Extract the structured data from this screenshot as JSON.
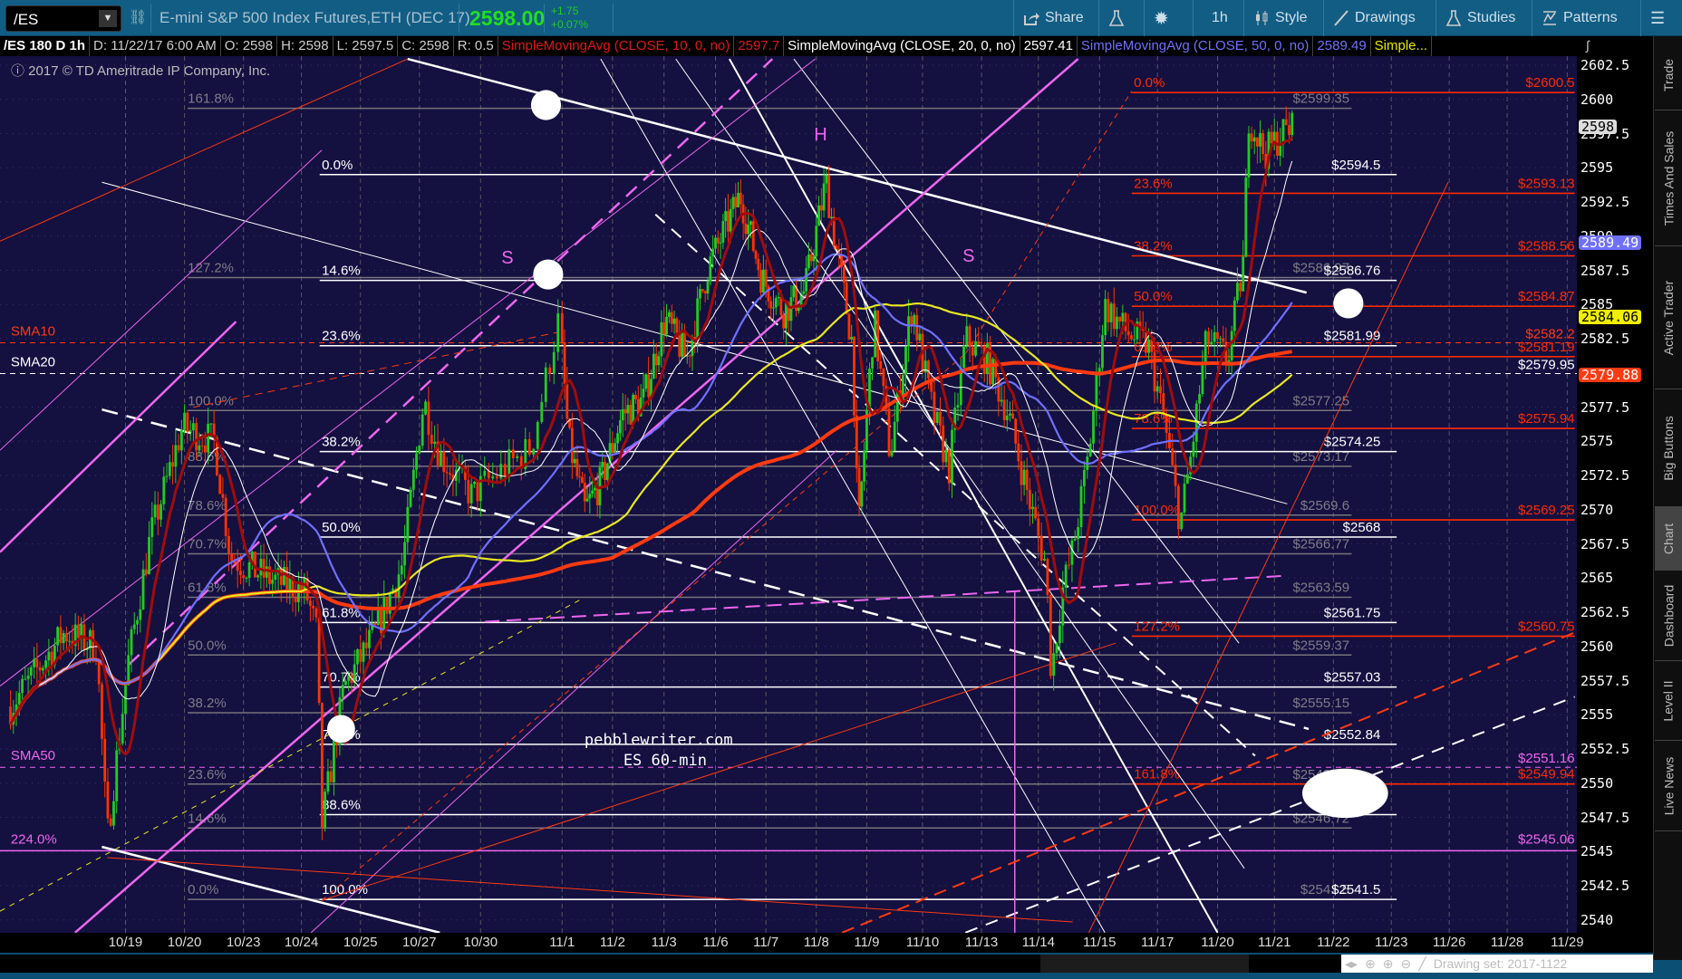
{
  "toolbar": {
    "symbol": "/ES",
    "instrument": "E-mini S&P 500 Index Futures,ETH (DEC 17)",
    "last": "2598.00",
    "change": "+1.75",
    "change_pct": "+0.07%",
    "share": "Share",
    "timeframe": "1h",
    "style": "Style",
    "drawings": "Drawings",
    "studies": "Studies",
    "patterns": "Patterns"
  },
  "infobar": {
    "sym": "/ES 180 D 1h",
    "date": "D: 11/22/17 6:00 AM",
    "open": "O: 2598",
    "high": "H: 2598",
    "low": "L: 2597.5",
    "close": "C: 2598",
    "range": "R: 0.5",
    "sma10": "SimpleMovingAvg (CLOSE, 10, 0, no)",
    "sma10_val": "2597.7",
    "sma20": "SimpleMovingAvg (CLOSE, 20, 0, no)",
    "sma20_val": "2597.41",
    "sma50": "SimpleMovingAvg (CLOSE, 50, 0, no)",
    "sma50_val": "2589.49",
    "more": "Simple..."
  },
  "copyright": "2017 © TD Ameritrade IP Company, Inc.",
  "tabs": [
    "Trade",
    "Times And Sales",
    "Active Trader",
    "Big Buttons",
    "Chart",
    "Dashboard",
    "Level II",
    "Live News"
  ],
  "selected_tab": "Chart",
  "bottom": {
    "drawing_set": "Drawing set: 2017-1122"
  },
  "colors": {
    "bg": "#141040",
    "up": "#22cc22",
    "down": "#ff3300",
    "sma10": "#a00c0c",
    "sma20": "#ffffff",
    "sma50": "#7070ff",
    "sma100": "#e8e820",
    "sma200": "#ff3a10",
    "magenta": "#ee66ee"
  },
  "chart_data": {
    "type": "candlestick",
    "title": "/ES 180 D 1h",
    "ylim": [
      2538.5,
      2603.5
    ],
    "y_ticks": [
      "2602.5",
      "2600",
      "2597.5",
      "2595",
      "2592.5",
      "2590",
      "2587.5",
      "2585",
      "2582.5",
      "2580",
      "2577.5",
      "2575",
      "2572.5",
      "2570",
      "2567.5",
      "2565",
      "2562.5",
      "2560",
      "2557.5",
      "2555",
      "2552.5",
      "2550",
      "2547.5",
      "2545",
      "2542.5",
      "2540"
    ],
    "x_labels": [
      "10/19",
      "10/20",
      "10/23",
      "10/24",
      "10/25",
      "10/27",
      "10/30",
      "11/1",
      "11/2",
      "11/3",
      "11/6",
      "11/7",
      "11/8",
      "11/9",
      "11/10",
      "11/13",
      "11/14",
      "11/15",
      "11/17",
      "11/20",
      "11/21",
      "11/22",
      "11/23",
      "11/26",
      "11/28",
      "11/29"
    ],
    "price_path": [
      [
        -1.95,
        2555.6
      ],
      [
        -1.04,
        2561
      ],
      [
        -0.49,
        2560
      ],
      [
        -0.31,
        2546
      ],
      [
        0.05,
        2559
      ],
      [
        0.42,
        2568
      ],
      [
        0.96,
        2576
      ],
      [
        1.51,
        2575
      ],
      [
        1.78,
        2566.5
      ],
      [
        2.43,
        2565
      ],
      [
        3.07,
        2564
      ],
      [
        3.26,
        2561
      ],
      [
        3.35,
        2547
      ],
      [
        3.72,
        2557
      ],
      [
        4.25,
        2561
      ],
      [
        4.71,
        2566
      ],
      [
        5.07,
        2578
      ],
      [
        5.33,
        2574
      ],
      [
        5.86,
        2571
      ],
      [
        6.29,
        2573
      ],
      [
        6.62,
        2574.5
      ],
      [
        6.95,
        2583.7
      ],
      [
        7.13,
        2575
      ],
      [
        7.45,
        2570
      ],
      [
        7.77,
        2572
      ],
      [
        8.19,
        2577
      ],
      [
        8.6,
        2578
      ],
      [
        9.02,
        2584
      ],
      [
        9.44,
        2581
      ],
      [
        9.85,
        2587.7
      ],
      [
        10.49,
        2593
      ],
      [
        10.91,
        2587
      ],
      [
        11.34,
        2584.5
      ],
      [
        11.77,
        2586
      ],
      [
        12.19,
        2594
      ],
      [
        12.4,
        2589
      ],
      [
        12.72,
        2582
      ],
      [
        12.83,
        2568
      ],
      [
        13.13,
        2584
      ],
      [
        13.42,
        2574
      ],
      [
        13.81,
        2585
      ],
      [
        14.18,
        2577
      ],
      [
        14.45,
        2573
      ],
      [
        14.73,
        2582.5
      ],
      [
        15.09,
        2581
      ],
      [
        15.47,
        2577
      ],
      [
        15.85,
        2570.5
      ],
      [
        16.12,
        2566
      ],
      [
        16.21,
        2558
      ],
      [
        16.39,
        2564
      ],
      [
        16.56,
        2567
      ],
      [
        16.82,
        2574
      ],
      [
        17.09,
        2585
      ],
      [
        17.46,
        2583
      ],
      [
        17.84,
        2582
      ],
      [
        18.11,
        2576.5
      ],
      [
        18.38,
        2569
      ],
      [
        18.56,
        2574
      ],
      [
        18.82,
        2582.5
      ],
      [
        19.18,
        2581
      ],
      [
        19.45,
        2588
      ],
      [
        19.55,
        2598.7
      ],
      [
        19.83,
        2596
      ],
      [
        20.13,
        2597.5
      ],
      [
        20.32,
        2598
      ]
    ],
    "badges": [
      {
        "value": "2598",
        "color": "#dddddd",
        "text": "#000"
      },
      {
        "value": "2589.49",
        "color": "#7070ff",
        "text": "#fff"
      },
      {
        "value": "2584.06",
        "color": "#f0f000",
        "text": "#000"
      },
      {
        "value": "2579.88",
        "color": "#ff3a10",
        "text": "#fff"
      }
    ],
    "fib_red": [
      {
        "pct": "0.0%",
        "price": 2600.5,
        "label": "$2600.5"
      },
      {
        "pct": "23.6%",
        "price": 2593.13,
        "label": "$2593.13"
      },
      {
        "pct": "38.2%",
        "price": 2588.56,
        "label": "$2588.56"
      },
      {
        "pct": "50.0%",
        "price": 2584.87,
        "label": "$2584.87"
      },
      {
        "pct": "61.8%",
        "price": 2581.19,
        "label": "$2581.19"
      },
      {
        "pct": "78.6%",
        "price": 2575.94,
        "label": "$2575.94"
      },
      {
        "pct": "100.0%",
        "price": 2569.25,
        "label": "$2569.25"
      },
      {
        "pct": "127.2%",
        "price": 2560.75,
        "label": "$2560.75"
      },
      {
        "pct": "161.8%",
        "price": 2549.94,
        "label": "$2549.94"
      }
    ],
    "fib_white": [
      {
        "pct": "0.0%",
        "price": 2594.5,
        "label": "$2594.5"
      },
      {
        "pct": "14.6%",
        "price": 2586.76,
        "label": "$2586.76"
      },
      {
        "pct": "23.6%",
        "price": 2581.99,
        "label": "$2581.99"
      },
      {
        "pct": "38.2%",
        "price": 2574.25,
        "label": "$2574.25"
      },
      {
        "pct": "50.0%",
        "price": 2568,
        "label": "$2568"
      },
      {
        "pct": "61.8%",
        "price": 2561.75,
        "label": "$2561.75"
      },
      {
        "pct": "70.7%",
        "price": 2557.03,
        "label": "$2557.03"
      },
      {
        "pct": "78.6%",
        "price": 2552.84,
        "label": "$2552.84"
      },
      {
        "pct": "88.6%",
        "price": 2547.7,
        "label": ""
      },
      {
        "pct": "100.0%",
        "price": 2541.5,
        "label": "$2541.5"
      }
    ],
    "fib_gray": [
      {
        "pct": "161.8%",
        "price": 2599.35,
        "label": "$2599.35"
      },
      {
        "pct": "127.2%",
        "price": 2586.97,
        "label": "$2586.97"
      },
      {
        "pct": "100.0%",
        "price": 2577.25,
        "label": "$2577.25"
      },
      {
        "pct": "88.6%",
        "price": 2573.17,
        "label": "$2573.17"
      },
      {
        "pct": "78.6%",
        "price": 2569.6,
        "label": "$2569.6"
      },
      {
        "pct": "70.7%",
        "price": 2566.77,
        "label": "$2566.77"
      },
      {
        "pct": "61.8%",
        "price": 2563.59,
        "label": "$2563.59"
      },
      {
        "pct": "50.0%",
        "price": 2559.37,
        "label": "$2559.37"
      },
      {
        "pct": "38.2%",
        "price": 2555.15,
        "label": "$2555.15"
      },
      {
        "pct": "23.6%",
        "price": 2549.93,
        "label": "$2549.93"
      },
      {
        "pct": "14.6%",
        "price": 2546.72,
        "label": "$2546.72"
      },
      {
        "pct": "0.0%",
        "price": 2541.5,
        "label": "$2541.5"
      }
    ],
    "ma_levels": [
      {
        "name": "SMA10",
        "price": 2582.2,
        "label": "$2582.2",
        "color": "#ff3a10"
      },
      {
        "name": "SMA20",
        "price": 2579.95,
        "label": "$2579.95",
        "color": "#ffffff"
      },
      {
        "name": "SMA50",
        "price": 2551.16,
        "label": "$2551.16",
        "color": "#ee66ee"
      }
    ],
    "extension": {
      "pct": "224.0%",
      "price": 2545.06,
      "label": "$2545.06"
    },
    "annotations": {
      "head": "H",
      "shoulder_left": "S",
      "shoulder_right": "S",
      "watermark_1": "pebblewriter.com",
      "watermark_2": "ES 60-min"
    }
  }
}
